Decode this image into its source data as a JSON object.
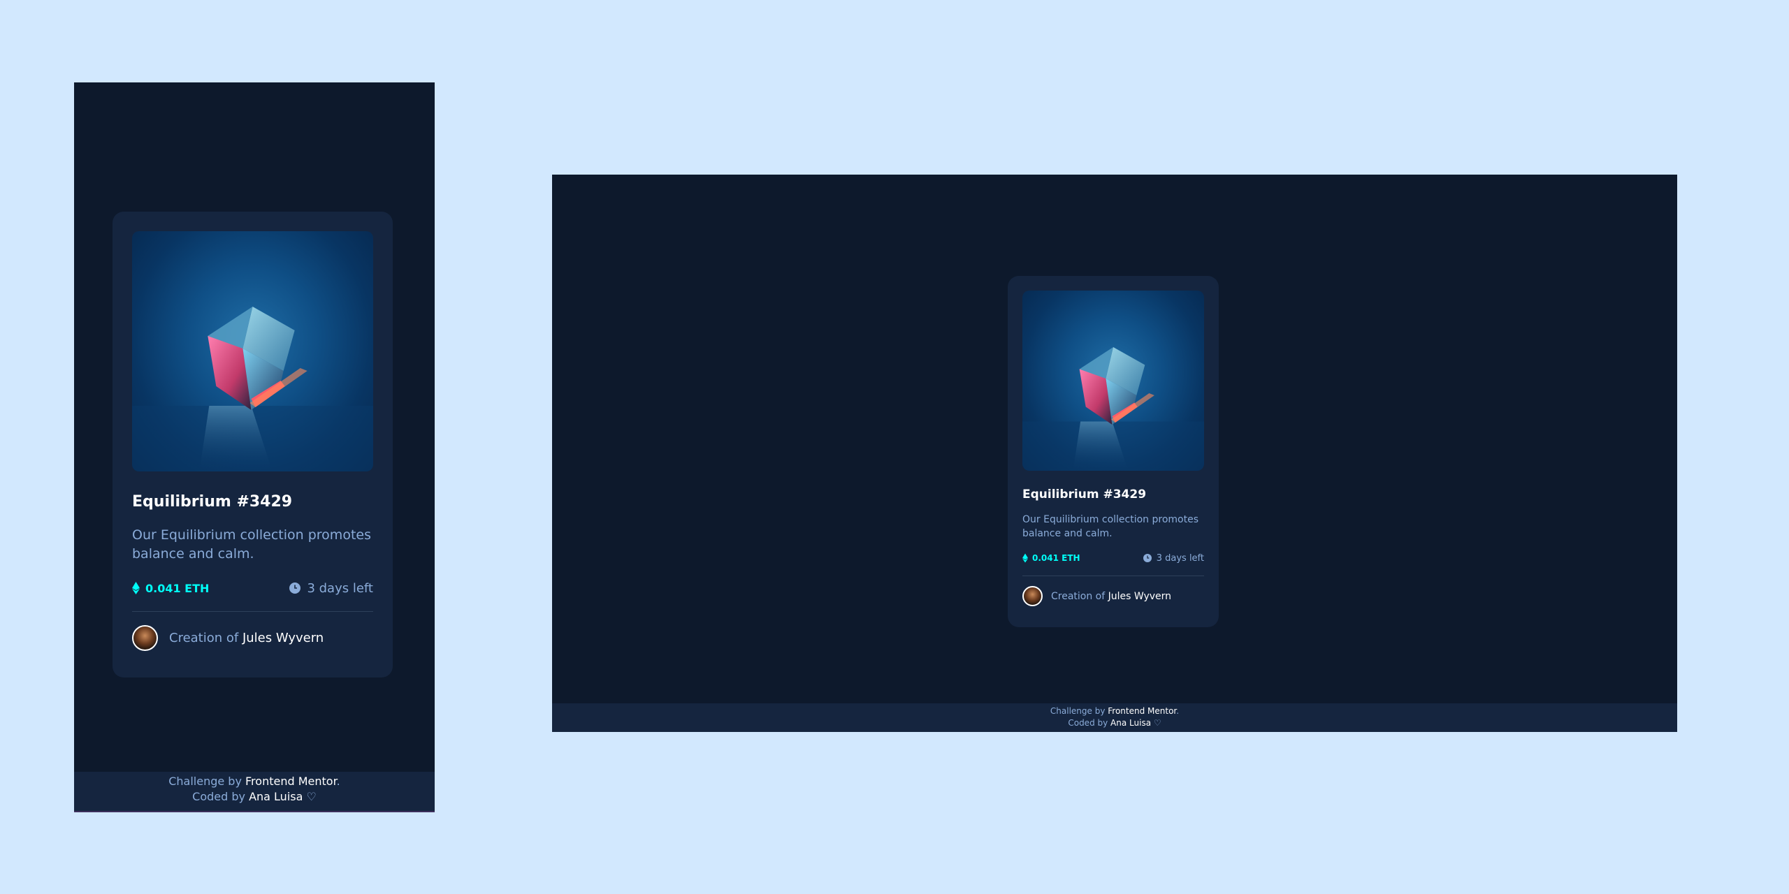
{
  "card": {
    "title": "Equilibrium #3429",
    "description": "Our Equilibrium collection promotes balance and calm.",
    "price": "0.041 ETH",
    "time_left": "3 days left",
    "creator_prefix": "Creation of",
    "creator_name": "Jules Wyvern",
    "image_icon": "cube-icon"
  },
  "footer": {
    "challenge_prefix": "Challenge by",
    "challenge_link": "Frontend Mentor",
    "challenge_suffix": ".",
    "coded_prefix": "Coded by",
    "coded_name": "Ana Luisa",
    "heart": "♡"
  },
  "colors": {
    "page_bg": "#d2e8fe",
    "screen_bg": "#0d192c",
    "card_bg": "#15253f",
    "accent_cyan": "#00fff8",
    "text_soft_blue": "#8bacd9",
    "text_white": "#ffffff"
  }
}
